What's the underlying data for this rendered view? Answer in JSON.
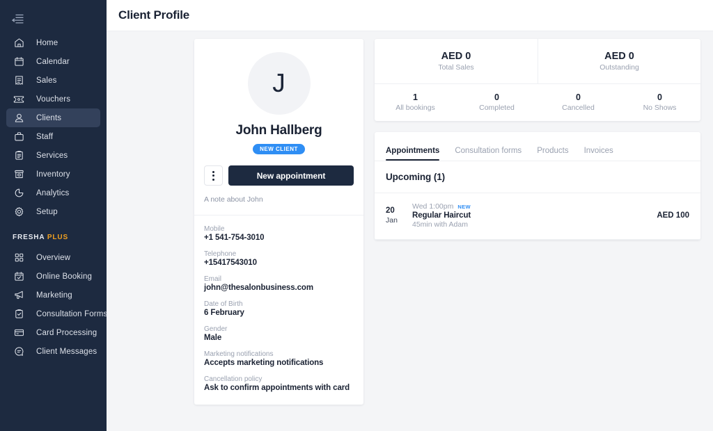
{
  "sidebar": {
    "collapse_icon": "collapse-menu-icon",
    "items": [
      {
        "label": "Home",
        "icon": "home-icon",
        "active": false
      },
      {
        "label": "Calendar",
        "icon": "calendar-icon",
        "active": false
      },
      {
        "label": "Sales",
        "icon": "receipt-icon",
        "active": false
      },
      {
        "label": "Vouchers",
        "icon": "voucher-ticket-icon",
        "active": false
      },
      {
        "label": "Clients",
        "icon": "person-icon",
        "active": true
      },
      {
        "label": "Staff",
        "icon": "briefcase-icon",
        "active": false
      },
      {
        "label": "Services",
        "icon": "clipboard-icon",
        "active": false
      },
      {
        "label": "Inventory",
        "icon": "box-icon",
        "active": false
      },
      {
        "label": "Analytics",
        "icon": "pie-chart-icon",
        "active": false
      },
      {
        "label": "Setup",
        "icon": "gear-icon",
        "active": false
      }
    ],
    "section": {
      "title": "FRESHA",
      "highlight": "PLUS"
    },
    "plus_items": [
      {
        "label": "Overview",
        "icon": "grid-icon"
      },
      {
        "label": "Online Booking",
        "icon": "calendar-check-icon"
      },
      {
        "label": "Marketing",
        "icon": "megaphone-icon"
      },
      {
        "label": "Consultation Forms",
        "icon": "clipboard-check-icon"
      },
      {
        "label": "Card Processing",
        "icon": "credit-card-icon"
      },
      {
        "label": "Client Messages",
        "icon": "chat-bubble-icon"
      }
    ]
  },
  "header": {
    "title": "Client Profile"
  },
  "profile": {
    "avatar_initial": "J",
    "name": "John Hallberg",
    "badge": "NEW CLIENT",
    "more_button": "more-options",
    "new_appointment_label": "New appointment",
    "note": "A note about John",
    "fields": [
      {
        "label": "Mobile",
        "value": "+1 541-754-3010"
      },
      {
        "label": "Telephone",
        "value": "+15417543010"
      },
      {
        "label": "Email",
        "value": "john@thesalonbusiness.com"
      },
      {
        "label": "Date of Birth",
        "value": "6 February"
      },
      {
        "label": "Gender",
        "value": "Male"
      },
      {
        "label": "Marketing notifications",
        "value": "Accepts marketing notifications"
      },
      {
        "label": "Cancellation policy",
        "value": "Ask to confirm appointments with card"
      }
    ]
  },
  "stats": {
    "money": [
      {
        "value": "AED 0",
        "label": "Total Sales"
      },
      {
        "value": "AED 0",
        "label": "Outstanding"
      }
    ],
    "counts": [
      {
        "value": "1",
        "label": "All bookings"
      },
      {
        "value": "0",
        "label": "Completed"
      },
      {
        "value": "0",
        "label": "Cancelled"
      },
      {
        "value": "0",
        "label": "No Shows"
      }
    ]
  },
  "tabs": [
    {
      "label": "Appointments",
      "active": true
    },
    {
      "label": "Consultation forms",
      "active": false
    },
    {
      "label": "Products",
      "active": false
    },
    {
      "label": "Invoices",
      "active": false
    }
  ],
  "appointments": {
    "section_title": "Upcoming (1)",
    "rows": [
      {
        "day": "20",
        "month": "Jan",
        "time": "Wed 1:00pm",
        "tag": "NEW",
        "title": "Regular Haircut",
        "subtitle": "45min with Adam",
        "price": "AED 100"
      }
    ]
  },
  "colors": {
    "sidebar_bg": "#1d2a40",
    "sidebar_active": "#33415b",
    "accent_blue": "#2f8ef4",
    "plus_orange": "#f0a020",
    "page_bg": "#f4f5f7",
    "text_dark": "#1a2233",
    "text_muted": "#9aa1b0"
  }
}
